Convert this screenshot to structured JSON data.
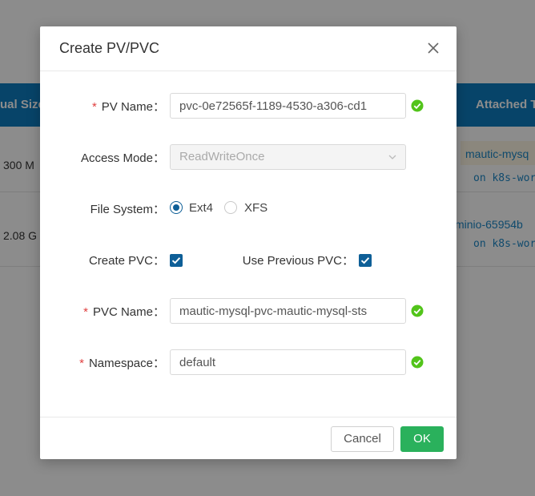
{
  "background": {
    "columns": {
      "actual_size": "ual Size",
      "attached": "Attached T"
    },
    "rows": [
      {
        "size": "300 M",
        "attached_name": "mautic-mysq",
        "attached_node": "on k8s-wor"
      },
      {
        "size": "2.08 G",
        "attached_name": "minio-65954b",
        "attached_node": "on k8s-wor"
      }
    ]
  },
  "modal": {
    "title": "Create PV/PVC",
    "fields": {
      "pv_name": {
        "label": "PV Name：",
        "value": "pvc-0e72565f-1189-4530-a306-cd1"
      },
      "access_mode": {
        "label": "Access Mode：",
        "value": "ReadWriteOnce"
      },
      "file_system": {
        "label": "File System：",
        "options": [
          "Ext4",
          "XFS"
        ],
        "selected": "Ext4"
      },
      "create_pvc": {
        "label": "Create PVC：",
        "checked": true
      },
      "use_previous_pvc": {
        "label": "Use Previous PVC：",
        "checked": true
      },
      "pvc_name": {
        "label": "PVC Name：",
        "value": "mautic-mysql-pvc-mautic-mysql-sts"
      },
      "namespace": {
        "label": "Namespace：",
        "value": "default"
      }
    },
    "required_mark": "*",
    "buttons": {
      "cancel": "Cancel",
      "ok": "OK"
    }
  },
  "colors": {
    "primary": "#0e5f97",
    "table_header": "#0e7dbf",
    "ok_button": "#2ab15c",
    "valid": "#52c41a",
    "required": "#e04040"
  }
}
